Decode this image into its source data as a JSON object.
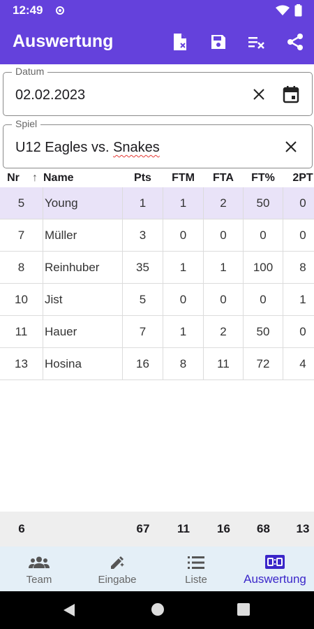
{
  "status_bar": {
    "time": "12:49"
  },
  "app_bar": {
    "title": "Auswertung",
    "actions": [
      "pdf-export-icon",
      "save-icon",
      "clear-list-icon",
      "share-icon"
    ]
  },
  "date_field": {
    "label": "Datum",
    "value": "02.02.2023"
  },
  "game_field": {
    "label": "Spiel",
    "value_prefix": "U12 Eagles vs. ",
    "value_flagged": "Snakes"
  },
  "table": {
    "sort_indicator": "↑",
    "columns": [
      "Nr",
      "Name",
      "Pts",
      "FTM",
      "FTA",
      "FT%",
      "2PT"
    ],
    "rows": [
      {
        "nr": "5",
        "name": "Young",
        "pts": "1",
        "ftm": "1",
        "fta": "2",
        "ftp": "50",
        "pt2": "0"
      },
      {
        "nr": "7",
        "name": "Müller",
        "pts": "3",
        "ftm": "0",
        "fta": "0",
        "ftp": "0",
        "pt2": "0"
      },
      {
        "nr": "8",
        "name": "Reinhuber",
        "pts": "35",
        "ftm": "1",
        "fta": "1",
        "ftp": "100",
        "pt2": "8"
      },
      {
        "nr": "10",
        "name": "Jist",
        "pts": "5",
        "ftm": "0",
        "fta": "0",
        "ftp": "0",
        "pt2": "1"
      },
      {
        "nr": "11",
        "name": "Hauer",
        "pts": "7",
        "ftm": "1",
        "fta": "2",
        "ftp": "50",
        "pt2": "0"
      },
      {
        "nr": "13",
        "name": "Hosina",
        "pts": "16",
        "ftm": "8",
        "fta": "11",
        "ftp": "72",
        "pt2": "4"
      }
    ],
    "totals": {
      "nr": "6",
      "pts": "67",
      "ftm": "11",
      "fta": "16",
      "ftp": "68",
      "pt2": "13"
    }
  },
  "bottom_nav": [
    {
      "label": "Team",
      "icon": "team-icon"
    },
    {
      "label": "Eingabe",
      "icon": "edit-icon"
    },
    {
      "label": "Liste",
      "icon": "list-icon"
    },
    {
      "label": "Auswertung",
      "icon": "scoreboard-icon",
      "active": true
    }
  ],
  "colors": {
    "primary": "#6441dc",
    "active_nav": "#3a26c9",
    "selected_row": "#e9e3f8",
    "nav_background": "#e4eff7"
  }
}
